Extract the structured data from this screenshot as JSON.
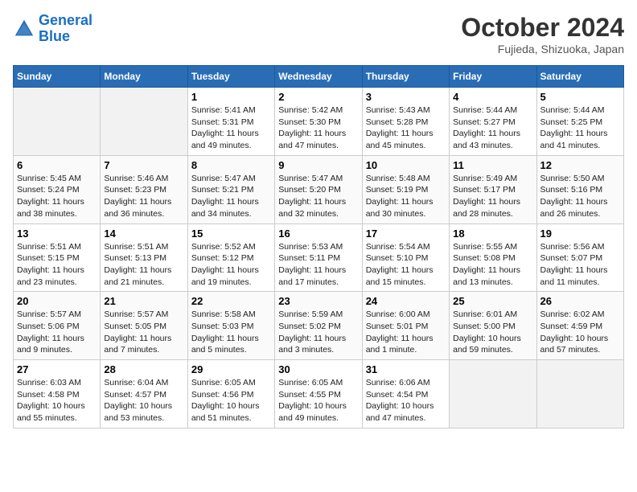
{
  "header": {
    "logo_line1": "General",
    "logo_line2": "Blue",
    "month": "October 2024",
    "location": "Fujieda, Shizuoka, Japan"
  },
  "weekdays": [
    "Sunday",
    "Monday",
    "Tuesday",
    "Wednesday",
    "Thursday",
    "Friday",
    "Saturday"
  ],
  "weeks": [
    [
      {
        "day": "",
        "info": ""
      },
      {
        "day": "",
        "info": ""
      },
      {
        "day": "1",
        "info": "Sunrise: 5:41 AM\nSunset: 5:31 PM\nDaylight: 11 hours and 49 minutes."
      },
      {
        "day": "2",
        "info": "Sunrise: 5:42 AM\nSunset: 5:30 PM\nDaylight: 11 hours and 47 minutes."
      },
      {
        "day": "3",
        "info": "Sunrise: 5:43 AM\nSunset: 5:28 PM\nDaylight: 11 hours and 45 minutes."
      },
      {
        "day": "4",
        "info": "Sunrise: 5:44 AM\nSunset: 5:27 PM\nDaylight: 11 hours and 43 minutes."
      },
      {
        "day": "5",
        "info": "Sunrise: 5:44 AM\nSunset: 5:25 PM\nDaylight: 11 hours and 41 minutes."
      }
    ],
    [
      {
        "day": "6",
        "info": "Sunrise: 5:45 AM\nSunset: 5:24 PM\nDaylight: 11 hours and 38 minutes."
      },
      {
        "day": "7",
        "info": "Sunrise: 5:46 AM\nSunset: 5:23 PM\nDaylight: 11 hours and 36 minutes."
      },
      {
        "day": "8",
        "info": "Sunrise: 5:47 AM\nSunset: 5:21 PM\nDaylight: 11 hours and 34 minutes."
      },
      {
        "day": "9",
        "info": "Sunrise: 5:47 AM\nSunset: 5:20 PM\nDaylight: 11 hours and 32 minutes."
      },
      {
        "day": "10",
        "info": "Sunrise: 5:48 AM\nSunset: 5:19 PM\nDaylight: 11 hours and 30 minutes."
      },
      {
        "day": "11",
        "info": "Sunrise: 5:49 AM\nSunset: 5:17 PM\nDaylight: 11 hours and 28 minutes."
      },
      {
        "day": "12",
        "info": "Sunrise: 5:50 AM\nSunset: 5:16 PM\nDaylight: 11 hours and 26 minutes."
      }
    ],
    [
      {
        "day": "13",
        "info": "Sunrise: 5:51 AM\nSunset: 5:15 PM\nDaylight: 11 hours and 23 minutes."
      },
      {
        "day": "14",
        "info": "Sunrise: 5:51 AM\nSunset: 5:13 PM\nDaylight: 11 hours and 21 minutes."
      },
      {
        "day": "15",
        "info": "Sunrise: 5:52 AM\nSunset: 5:12 PM\nDaylight: 11 hours and 19 minutes."
      },
      {
        "day": "16",
        "info": "Sunrise: 5:53 AM\nSunset: 5:11 PM\nDaylight: 11 hours and 17 minutes."
      },
      {
        "day": "17",
        "info": "Sunrise: 5:54 AM\nSunset: 5:10 PM\nDaylight: 11 hours and 15 minutes."
      },
      {
        "day": "18",
        "info": "Sunrise: 5:55 AM\nSunset: 5:08 PM\nDaylight: 11 hours and 13 minutes."
      },
      {
        "day": "19",
        "info": "Sunrise: 5:56 AM\nSunset: 5:07 PM\nDaylight: 11 hours and 11 minutes."
      }
    ],
    [
      {
        "day": "20",
        "info": "Sunrise: 5:57 AM\nSunset: 5:06 PM\nDaylight: 11 hours and 9 minutes."
      },
      {
        "day": "21",
        "info": "Sunrise: 5:57 AM\nSunset: 5:05 PM\nDaylight: 11 hours and 7 minutes."
      },
      {
        "day": "22",
        "info": "Sunrise: 5:58 AM\nSunset: 5:03 PM\nDaylight: 11 hours and 5 minutes."
      },
      {
        "day": "23",
        "info": "Sunrise: 5:59 AM\nSunset: 5:02 PM\nDaylight: 11 hours and 3 minutes."
      },
      {
        "day": "24",
        "info": "Sunrise: 6:00 AM\nSunset: 5:01 PM\nDaylight: 11 hours and 1 minute."
      },
      {
        "day": "25",
        "info": "Sunrise: 6:01 AM\nSunset: 5:00 PM\nDaylight: 10 hours and 59 minutes."
      },
      {
        "day": "26",
        "info": "Sunrise: 6:02 AM\nSunset: 4:59 PM\nDaylight: 10 hours and 57 minutes."
      }
    ],
    [
      {
        "day": "27",
        "info": "Sunrise: 6:03 AM\nSunset: 4:58 PM\nDaylight: 10 hours and 55 minutes."
      },
      {
        "day": "28",
        "info": "Sunrise: 6:04 AM\nSunset: 4:57 PM\nDaylight: 10 hours and 53 minutes."
      },
      {
        "day": "29",
        "info": "Sunrise: 6:05 AM\nSunset: 4:56 PM\nDaylight: 10 hours and 51 minutes."
      },
      {
        "day": "30",
        "info": "Sunrise: 6:05 AM\nSunset: 4:55 PM\nDaylight: 10 hours and 49 minutes."
      },
      {
        "day": "31",
        "info": "Sunrise: 6:06 AM\nSunset: 4:54 PM\nDaylight: 10 hours and 47 minutes."
      },
      {
        "day": "",
        "info": ""
      },
      {
        "day": "",
        "info": ""
      }
    ]
  ]
}
